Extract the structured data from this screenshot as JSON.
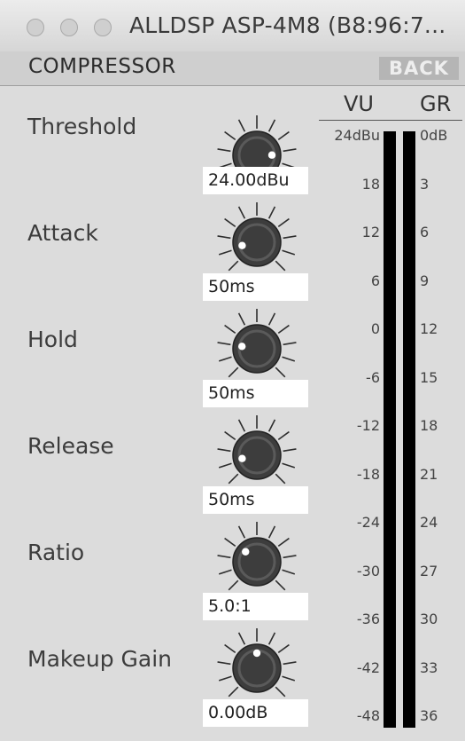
{
  "window": {
    "title": "ALLDSP ASP-4M8 (B8:96:7..."
  },
  "header": {
    "section_title": "COMPRESSOR",
    "back_label": "BACK"
  },
  "parameters": [
    {
      "label": "Threshold",
      "value": "24.00dBu",
      "knob_level": 0.83
    },
    {
      "label": "Attack",
      "value": "50ms",
      "knob_level": 0.12
    },
    {
      "label": "Hold",
      "value": "50ms",
      "knob_level": 0.2
    },
    {
      "label": "Release",
      "value": "50ms",
      "knob_level": 0.12
    },
    {
      "label": "Ratio",
      "value": "5.0:1",
      "knob_level": 0.32
    },
    {
      "label": "Makeup Gain",
      "value": "0.00dB",
      "knob_level": 0.5
    }
  ],
  "meter": {
    "vu_heading": "VU",
    "gr_heading": "GR",
    "vu_scale": [
      "24dBu",
      "18",
      "12",
      "6",
      "0",
      "-6",
      "-12",
      "-18",
      "-24",
      "-30",
      "-36",
      "-42",
      "-48"
    ],
    "gr_scale": [
      "0dB",
      "3",
      "6",
      "9",
      "12",
      "15",
      "18",
      "21",
      "24",
      "27",
      "30",
      "33",
      "36"
    ]
  },
  "colors": {
    "panel": "#dcdcdc",
    "knob_body": "#3d3d3d",
    "knob_indicator": "#ffffff",
    "meter_bar": "#000000",
    "back_button": "#b5b5b5"
  }
}
